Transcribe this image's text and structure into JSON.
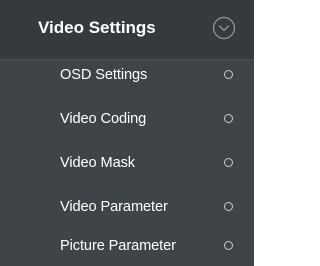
{
  "menu": {
    "title": "Video Settings",
    "collapse_icon": "chevron-down-circle-icon",
    "items": [
      {
        "label": "OSD Settings",
        "icon": "circle-bullet-icon"
      },
      {
        "label": "Video Coding",
        "icon": "circle-bullet-icon"
      },
      {
        "label": "Video Mask",
        "icon": "circle-bullet-icon"
      },
      {
        "label": "Video Parameter",
        "icon": "circle-bullet-icon"
      },
      {
        "label": "Picture Parameter",
        "icon": "circle-bullet-icon"
      }
    ]
  },
  "colors": {
    "background": "#3f4448",
    "header_background": "#353a3e",
    "text": "#ffffff",
    "icon": "#c9cbcd"
  }
}
